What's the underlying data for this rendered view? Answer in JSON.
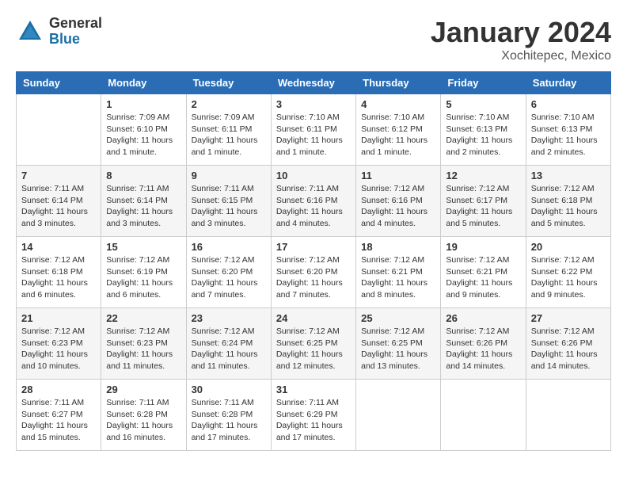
{
  "header": {
    "logo_general": "General",
    "logo_blue": "Blue",
    "month_title": "January 2024",
    "location": "Xochitepec, Mexico"
  },
  "weekdays": [
    "Sunday",
    "Monday",
    "Tuesday",
    "Wednesday",
    "Thursday",
    "Friday",
    "Saturday"
  ],
  "weeks": [
    [
      {
        "day": "",
        "info": ""
      },
      {
        "day": "1",
        "info": "Sunrise: 7:09 AM\nSunset: 6:10 PM\nDaylight: 11 hours\nand 1 minute."
      },
      {
        "day": "2",
        "info": "Sunrise: 7:09 AM\nSunset: 6:11 PM\nDaylight: 11 hours\nand 1 minute."
      },
      {
        "day": "3",
        "info": "Sunrise: 7:10 AM\nSunset: 6:11 PM\nDaylight: 11 hours\nand 1 minute."
      },
      {
        "day": "4",
        "info": "Sunrise: 7:10 AM\nSunset: 6:12 PM\nDaylight: 11 hours\nand 1 minute."
      },
      {
        "day": "5",
        "info": "Sunrise: 7:10 AM\nSunset: 6:13 PM\nDaylight: 11 hours\nand 2 minutes."
      },
      {
        "day": "6",
        "info": "Sunrise: 7:10 AM\nSunset: 6:13 PM\nDaylight: 11 hours\nand 2 minutes."
      }
    ],
    [
      {
        "day": "7",
        "info": "Sunrise: 7:11 AM\nSunset: 6:14 PM\nDaylight: 11 hours\nand 3 minutes."
      },
      {
        "day": "8",
        "info": "Sunrise: 7:11 AM\nSunset: 6:14 PM\nDaylight: 11 hours\nand 3 minutes."
      },
      {
        "day": "9",
        "info": "Sunrise: 7:11 AM\nSunset: 6:15 PM\nDaylight: 11 hours\nand 3 minutes."
      },
      {
        "day": "10",
        "info": "Sunrise: 7:11 AM\nSunset: 6:16 PM\nDaylight: 11 hours\nand 4 minutes."
      },
      {
        "day": "11",
        "info": "Sunrise: 7:12 AM\nSunset: 6:16 PM\nDaylight: 11 hours\nand 4 minutes."
      },
      {
        "day": "12",
        "info": "Sunrise: 7:12 AM\nSunset: 6:17 PM\nDaylight: 11 hours\nand 5 minutes."
      },
      {
        "day": "13",
        "info": "Sunrise: 7:12 AM\nSunset: 6:18 PM\nDaylight: 11 hours\nand 5 minutes."
      }
    ],
    [
      {
        "day": "14",
        "info": "Sunrise: 7:12 AM\nSunset: 6:18 PM\nDaylight: 11 hours\nand 6 minutes."
      },
      {
        "day": "15",
        "info": "Sunrise: 7:12 AM\nSunset: 6:19 PM\nDaylight: 11 hours\nand 6 minutes."
      },
      {
        "day": "16",
        "info": "Sunrise: 7:12 AM\nSunset: 6:20 PM\nDaylight: 11 hours\nand 7 minutes."
      },
      {
        "day": "17",
        "info": "Sunrise: 7:12 AM\nSunset: 6:20 PM\nDaylight: 11 hours\nand 7 minutes."
      },
      {
        "day": "18",
        "info": "Sunrise: 7:12 AM\nSunset: 6:21 PM\nDaylight: 11 hours\nand 8 minutes."
      },
      {
        "day": "19",
        "info": "Sunrise: 7:12 AM\nSunset: 6:21 PM\nDaylight: 11 hours\nand 9 minutes."
      },
      {
        "day": "20",
        "info": "Sunrise: 7:12 AM\nSunset: 6:22 PM\nDaylight: 11 hours\nand 9 minutes."
      }
    ],
    [
      {
        "day": "21",
        "info": "Sunrise: 7:12 AM\nSunset: 6:23 PM\nDaylight: 11 hours\nand 10 minutes."
      },
      {
        "day": "22",
        "info": "Sunrise: 7:12 AM\nSunset: 6:23 PM\nDaylight: 11 hours\nand 11 minutes."
      },
      {
        "day": "23",
        "info": "Sunrise: 7:12 AM\nSunset: 6:24 PM\nDaylight: 11 hours\nand 11 minutes."
      },
      {
        "day": "24",
        "info": "Sunrise: 7:12 AM\nSunset: 6:25 PM\nDaylight: 11 hours\nand 12 minutes."
      },
      {
        "day": "25",
        "info": "Sunrise: 7:12 AM\nSunset: 6:25 PM\nDaylight: 11 hours\nand 13 minutes."
      },
      {
        "day": "26",
        "info": "Sunrise: 7:12 AM\nSunset: 6:26 PM\nDaylight: 11 hours\nand 14 minutes."
      },
      {
        "day": "27",
        "info": "Sunrise: 7:12 AM\nSunset: 6:26 PM\nDaylight: 11 hours\nand 14 minutes."
      }
    ],
    [
      {
        "day": "28",
        "info": "Sunrise: 7:11 AM\nSunset: 6:27 PM\nDaylight: 11 hours\nand 15 minutes."
      },
      {
        "day": "29",
        "info": "Sunrise: 7:11 AM\nSunset: 6:28 PM\nDaylight: 11 hours\nand 16 minutes."
      },
      {
        "day": "30",
        "info": "Sunrise: 7:11 AM\nSunset: 6:28 PM\nDaylight: 11 hours\nand 17 minutes."
      },
      {
        "day": "31",
        "info": "Sunrise: 7:11 AM\nSunset: 6:29 PM\nDaylight: 11 hours\nand 17 minutes."
      },
      {
        "day": "",
        "info": ""
      },
      {
        "day": "",
        "info": ""
      },
      {
        "day": "",
        "info": ""
      }
    ]
  ]
}
